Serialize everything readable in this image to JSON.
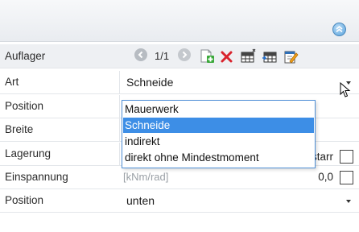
{
  "header": {
    "label": "Auflager",
    "page_indicator": "1/1",
    "toolbar_icons": [
      "nav-prev-icon",
      "nav-next-icon",
      "add-icon",
      "delete-icon",
      "table-icon",
      "table-insert-icon",
      "edit-icon"
    ]
  },
  "rows": {
    "art": {
      "label": "Art",
      "value": "Schneide"
    },
    "position": {
      "label": "Position"
    },
    "breite": {
      "label": "Breite"
    },
    "lagerung": {
      "label": "Lagerung",
      "value_partial": "starr"
    },
    "einspannung": {
      "label": "Einspannung",
      "unit": "[kNm/rad]",
      "value": "0,0"
    },
    "position2": {
      "label": "Position",
      "value": "unten"
    }
  },
  "dropdown": {
    "options": [
      "Mauerwerk",
      "Schneide",
      "indirekt",
      "direkt ohne Mindestmoment"
    ],
    "selected": "Schneide"
  },
  "colors": {
    "selection": "#3d8ee6",
    "focus_border": "#4f8fd6",
    "delete": "#d9232d",
    "add": "#3aa83a"
  }
}
